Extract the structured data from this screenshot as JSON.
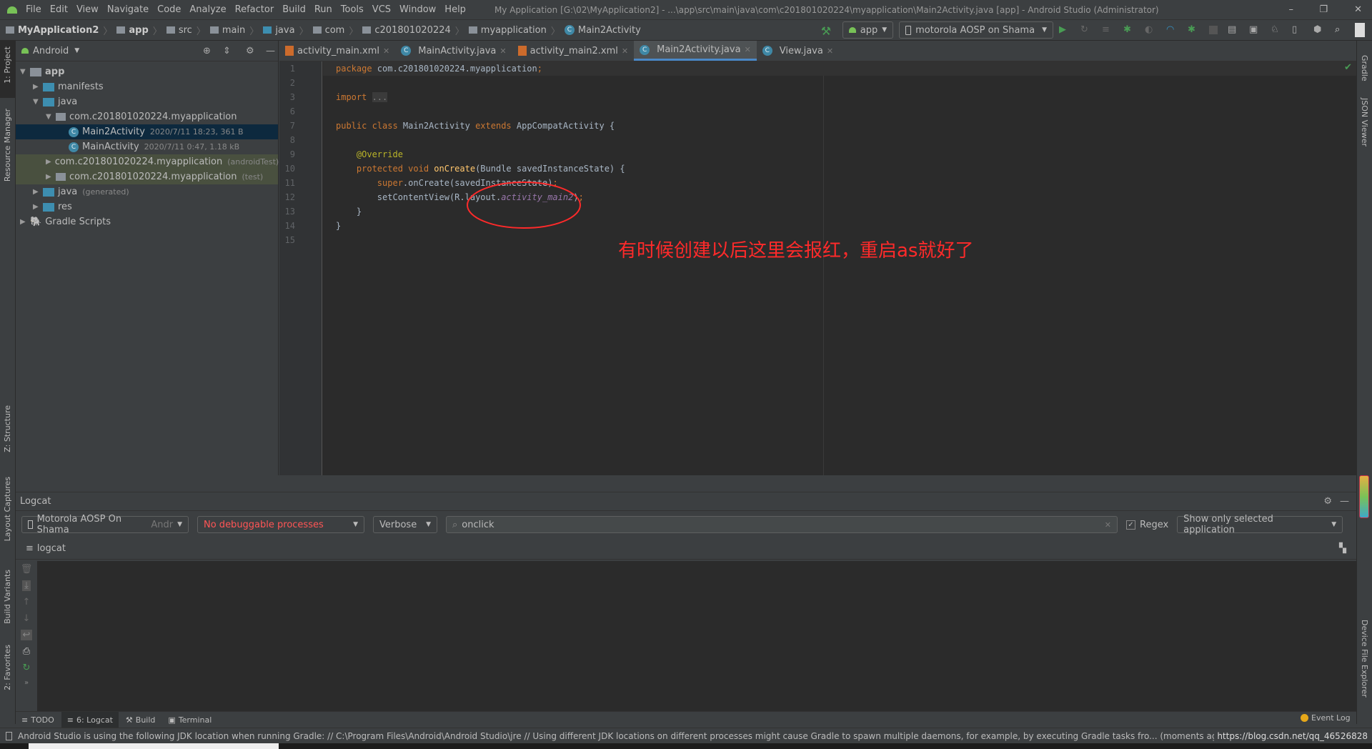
{
  "titlebar": {
    "menu": [
      "File",
      "Edit",
      "View",
      "Navigate",
      "Code",
      "Analyze",
      "Refactor",
      "Build",
      "Run",
      "Tools",
      "VCS",
      "Window",
      "Help"
    ],
    "title": "My Application [G:\\02\\MyApplication2] - ...\\app\\src\\main\\java\\com\\c201801020224\\myapplication\\Main2Activity.java [app] - Android Studio (Administrator)",
    "minimize": "–",
    "maximize": "❐",
    "close": "✕"
  },
  "breadcrumb": [
    "MyApplication2",
    "app",
    "src",
    "main",
    "java",
    "com",
    "c201801020224",
    "myapplication",
    "Main2Activity"
  ],
  "toolbar": {
    "config": "app",
    "device": "motorola AOSP on Shama",
    "icons": [
      "build-hammer-icon",
      "run-icon",
      "apply-changes-icon",
      "apply-code-icon",
      "debug-icon",
      "attach-debugger-icon",
      "profile-icon",
      "stop-icon",
      "project-structure-icon",
      "sdk-manager-icon",
      "avd-manager-icon",
      "device-manager-icon",
      "search-icon"
    ]
  },
  "project": {
    "view": "Android",
    "tree": [
      {
        "level": 0,
        "open": true,
        "icon": "module",
        "label": "app",
        "bold": true
      },
      {
        "level": 1,
        "open": false,
        "icon": "folder",
        "label": "manifests"
      },
      {
        "level": 1,
        "open": true,
        "icon": "folder",
        "label": "java"
      },
      {
        "level": 2,
        "open": true,
        "icon": "package",
        "label": "com.c201801020224.myapplication"
      },
      {
        "level": 3,
        "icon": "class",
        "label": "Main2Activity",
        "meta": "2020/7/11 18:23, 361 B",
        "selected": true
      },
      {
        "level": 3,
        "icon": "class",
        "label": "MainActivity",
        "meta": "2020/7/11 0:47, 1.18 kB"
      },
      {
        "level": 2,
        "open": false,
        "icon": "package",
        "label": "com.c201801020224.myapplication",
        "meta": "(androidTest)",
        "test": true
      },
      {
        "level": 2,
        "open": false,
        "icon": "package",
        "label": "com.c201801020224.myapplication",
        "meta": "(test)",
        "test": true
      },
      {
        "level": 1,
        "open": false,
        "icon": "folder",
        "label": "java",
        "meta": "(generated)"
      },
      {
        "level": 1,
        "open": false,
        "icon": "folder",
        "label": "res"
      },
      {
        "level": 0,
        "open": false,
        "icon": "gradle",
        "label": "Gradle Scripts"
      }
    ]
  },
  "left_stripe": [
    "1: Project",
    "Resource Manager",
    "Z: Structure",
    "Layout Captures",
    "Build Variants",
    "2: Favorites"
  ],
  "right_stripe": [
    "Gradle",
    "JSON Viewer",
    "Device File Explorer"
  ],
  "tabs": [
    {
      "label": "activity_main.xml",
      "type": "xml"
    },
    {
      "label": "MainActivity.java",
      "type": "class"
    },
    {
      "label": "activity_main2.xml",
      "type": "xml"
    },
    {
      "label": "Main2Activity.java",
      "type": "class",
      "active": true
    },
    {
      "label": "View.java",
      "type": "class"
    }
  ],
  "code": [
    {
      "n": "1",
      "tokens": [
        [
          "kw",
          "package "
        ],
        [
          "pl",
          "com.c201801020224.myapplication"
        ],
        [
          "kw",
          ";"
        ]
      ]
    },
    {
      "n": "2",
      "tokens": []
    },
    {
      "n": "3",
      "tokens": [
        [
          "kw",
          "import "
        ],
        [
          "fd",
          "..."
        ]
      ]
    },
    {
      "n": "6",
      "tokens": []
    },
    {
      "n": "7",
      "tokens": [
        [
          "kw",
          "public class "
        ],
        [
          "pl",
          "Main2Activity "
        ],
        [
          "kw",
          "extends "
        ],
        [
          "pl",
          "AppCompatActivity {"
        ]
      ]
    },
    {
      "n": "8",
      "tokens": []
    },
    {
      "n": "9",
      "tokens": [
        [
          "pl",
          "    "
        ],
        [
          "an",
          "@Override"
        ]
      ]
    },
    {
      "n": "10",
      "tokens": [
        [
          "pl",
          "    "
        ],
        [
          "kw",
          "protected void "
        ],
        [
          "fn",
          "onCreate"
        ],
        [
          "pl",
          "(Bundle savedInstanceState) {"
        ]
      ]
    },
    {
      "n": "11",
      "tokens": [
        [
          "pl",
          "        "
        ],
        [
          "kw",
          "super"
        ],
        [
          "pl",
          ".onCreate(savedInstanceState)"
        ],
        [
          "kw",
          ";"
        ]
      ]
    },
    {
      "n": "12",
      "tokens": [
        [
          "pl",
          "        setContentView(R.layout."
        ],
        [
          "it",
          "activity_main2"
        ],
        [
          "pl",
          ")"
        ],
        [
          "kw",
          ";"
        ]
      ]
    },
    {
      "n": "13",
      "tokens": [
        [
          "pl",
          "    }"
        ]
      ]
    },
    {
      "n": "14",
      "tokens": [
        [
          "pl",
          "}"
        ]
      ]
    },
    {
      "n": "15",
      "tokens": []
    }
  ],
  "annotation": {
    "text": "有时候创建以后这里会报红，重启as就好了",
    "color": "#ff2a2a"
  },
  "logcat": {
    "title": "Logcat",
    "device": "Motorola AOSP On Shama",
    "device_suffix": "Andr",
    "process": "No debuggable processes",
    "level": "Verbose",
    "search": "onclick",
    "regex_label": "Regex",
    "regex_checked": true,
    "filter": "Show only selected application",
    "tab": "logcat"
  },
  "bottom_tabs": [
    "TODO",
    "6: Logcat",
    "Build",
    "Terminal"
  ],
  "event_log": "Event Log",
  "status": "Android Studio is using the following JDK location when running Gradle: // C:\\Program Files\\Android\\Android Studio\\jre // Using different JDK locations on different processes might cause Gradle to spawn multiple daemons, for example, by executing Gradle tasks fro... (moments ago)",
  "watermark": "https://blog.csdn.net/qq_46526828",
  "colors": {
    "accent": "#4a88c7",
    "error": "#ff5555",
    "run": "#499c54"
  }
}
